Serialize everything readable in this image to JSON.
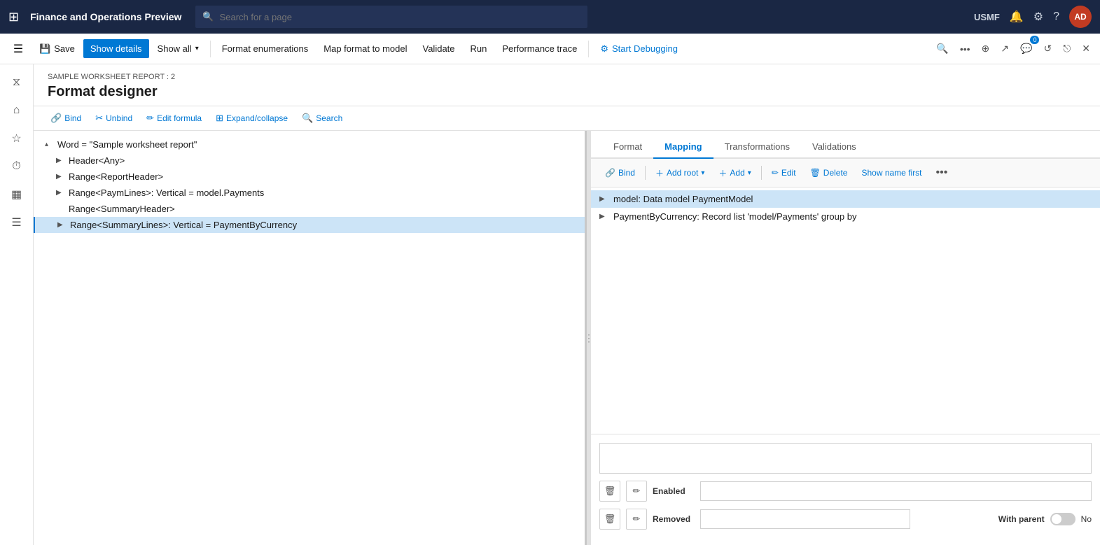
{
  "app": {
    "title": "Finance and Operations Preview",
    "environment": "USMF",
    "avatar_initials": "AD"
  },
  "search_bar": {
    "placeholder": "Search for a page"
  },
  "command_bar": {
    "save_label": "Save",
    "show_details_label": "Show details",
    "show_all_label": "Show all",
    "format_enumerations_label": "Format enumerations",
    "map_format_to_model_label": "Map format to model",
    "validate_label": "Validate",
    "run_label": "Run",
    "performance_trace_label": "Performance trace",
    "start_debugging_label": "Start Debugging"
  },
  "page": {
    "breadcrumb": "SAMPLE WORKSHEET REPORT : 2",
    "title": "Format designer"
  },
  "format_toolbar": {
    "bind_label": "Bind",
    "unbind_label": "Unbind",
    "edit_formula_label": "Edit formula",
    "expand_collapse_label": "Expand/collapse",
    "search_label": "Search"
  },
  "tree": {
    "items": [
      {
        "label": "Word = \"Sample worksheet report\"",
        "level": 0,
        "has_chevron": true,
        "chevron": "▴"
      },
      {
        "label": "Header<Any>",
        "level": 1,
        "has_chevron": true,
        "chevron": "▶"
      },
      {
        "label": "Range<ReportHeader>",
        "level": 1,
        "has_chevron": true,
        "chevron": "▶"
      },
      {
        "label": "Range<PaymLines>: Vertical = model.Payments",
        "level": 1,
        "has_chevron": true,
        "chevron": "▶"
      },
      {
        "label": "Range<SummaryHeader>",
        "level": 1,
        "has_chevron": false,
        "chevron": ""
      },
      {
        "label": "Range<SummaryLines>: Vertical = PaymentByCurrency",
        "level": 1,
        "has_chevron": true,
        "chevron": "▶",
        "selected": true
      }
    ]
  },
  "mapping": {
    "tabs": [
      {
        "label": "Format",
        "active": false
      },
      {
        "label": "Mapping",
        "active": true
      },
      {
        "label": "Transformations",
        "active": false
      },
      {
        "label": "Validations",
        "active": false
      }
    ],
    "toolbar": {
      "bind_label": "Bind",
      "add_root_label": "Add root",
      "add_label": "Add",
      "edit_label": "Edit",
      "delete_label": "Delete",
      "show_name_first_label": "Show name first"
    },
    "items": [
      {
        "label": "model: Data model PaymentModel",
        "level": 0,
        "chevron": "▶",
        "selected": true
      },
      {
        "label": "PaymentByCurrency: Record list 'model/Payments' group by",
        "level": 0,
        "chevron": "▶",
        "selected": false
      }
    ]
  },
  "bottom": {
    "large_input_placeholder": "",
    "enabled_label": "Enabled",
    "enabled_placeholder": "",
    "removed_label": "Removed",
    "removed_placeholder": "",
    "with_parent_label": "With parent",
    "toggle_value": "No"
  },
  "icons": {
    "grid": "⊞",
    "filter": "⧖",
    "home": "⌂",
    "star": "☆",
    "clock": "⏱",
    "table": "▦",
    "list": "☰",
    "search": "🔍",
    "settings": "⚙",
    "help": "?",
    "notification": "🔔",
    "more": "•••",
    "bookmark": "⊕",
    "person": "👤",
    "refresh": "↺",
    "external": "⎋",
    "close": "✕",
    "trash": "🗑",
    "pencil": "✏",
    "link": "🔗",
    "unlink": "✂",
    "formula": "ƒ",
    "expand": "⊞"
  }
}
